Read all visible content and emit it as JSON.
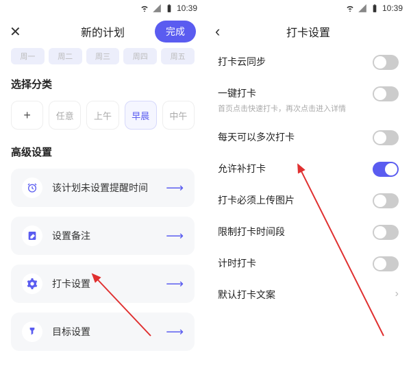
{
  "status": {
    "time": "10:39"
  },
  "left": {
    "title": "新的计划",
    "done": "完成",
    "days": [
      "周一",
      "周二",
      "周三",
      "周四",
      "周五"
    ],
    "category_section": "选择分类",
    "categories": {
      "any": "任意",
      "morning": "上午",
      "earlyMorning": "早晨",
      "noon": "中午"
    },
    "advanced_section": "高级设置",
    "cards": {
      "reminder": "该计划未设置提醒时间",
      "note": "设置备注",
      "checkin": "打卡设置",
      "goal": "目标设置"
    }
  },
  "right": {
    "title": "打卡设置",
    "rows": {
      "cloud": {
        "label": "打卡云同步",
        "on": false
      },
      "onetap": {
        "label": "一键打卡",
        "sub": "首页点击快速打卡，再次点击进入详情",
        "on": false
      },
      "multi": {
        "label": "每天可以多次打卡",
        "on": false
      },
      "makeup": {
        "label": "允许补打卡",
        "on": true
      },
      "image": {
        "label": "打卡必须上传图片",
        "on": false
      },
      "limit": {
        "label": "限制打卡时间段",
        "on": false
      },
      "timer": {
        "label": "计时打卡",
        "on": false
      },
      "copy": {
        "label": "默认打卡文案"
      }
    }
  }
}
